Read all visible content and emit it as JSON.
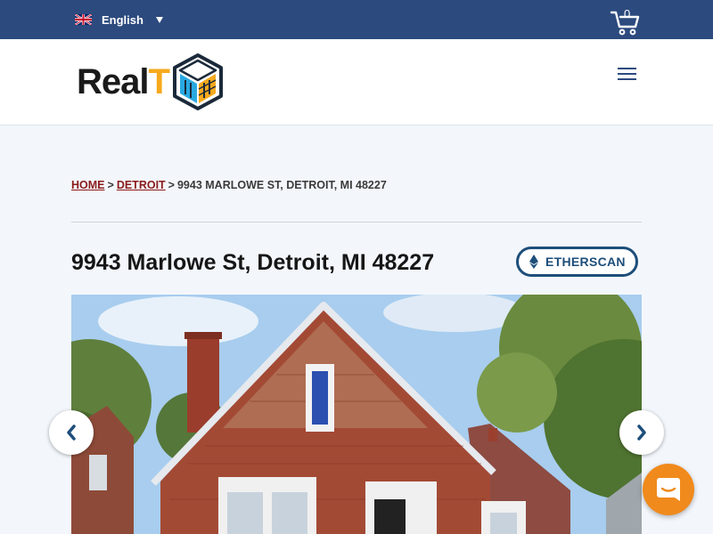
{
  "topbar": {
    "language": "English",
    "language_icon": "uk-flag-icon",
    "cart_count": "0",
    "cart_icon": "shopping-cart-icon",
    "background_color": "#2c4a7e"
  },
  "header": {
    "logo_text_main": "Real",
    "logo_text_accent": "T",
    "logo_icon": "realt-cube-logo-icon",
    "menu_icon": "hamburger-menu-icon",
    "accent_color": "#f6a91c"
  },
  "breadcrumb": {
    "home": "HOME",
    "separator": ">",
    "city": "DETROIT",
    "current": "9943 MARLOWE ST, DETROIT, MI 48227"
  },
  "property": {
    "title": "9943 Marlowe St, Detroit, MI 48227",
    "etherscan_label": "ETHERSCAN",
    "etherscan_icon": "ethereum-icon"
  },
  "gallery": {
    "image_description": "house-photo",
    "prev_icon": "chevron-left-icon",
    "next_icon": "chevron-right-icon"
  },
  "chat": {
    "icon": "chat-bubble-icon",
    "color": "#f08a1c"
  }
}
